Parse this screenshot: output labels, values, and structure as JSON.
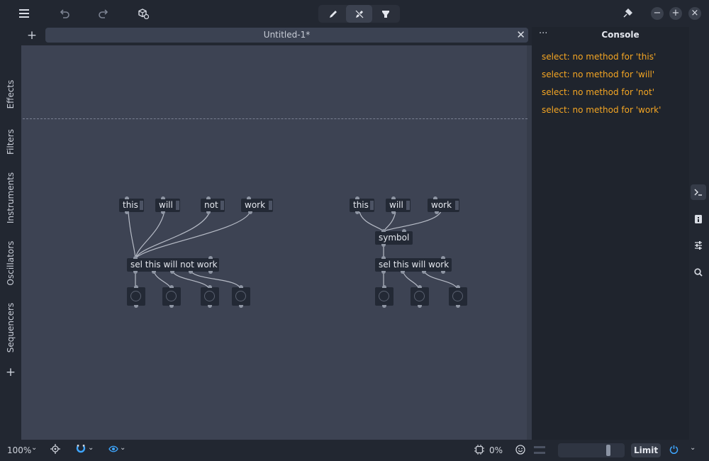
{
  "topbar": {
    "icons": [
      "menu-icon",
      "undo-icon",
      "redo-icon",
      "add-object-icon",
      "edit-mode-icon",
      "run-mode-icon",
      "presentation-mode-icon",
      "plugin-icon",
      "minimize-icon",
      "maximize-icon",
      "close-icon"
    ]
  },
  "tab": {
    "title": "Untitled-1*",
    "add_label": "+",
    "close_label": "✕"
  },
  "sidebar": {
    "categories": [
      "Effects",
      "Filters",
      "Instruments",
      "Oscillators",
      "Sequencers"
    ],
    "add_label": "+"
  },
  "patch_left": {
    "messages": [
      "this",
      "will",
      "not",
      "work"
    ],
    "select_object": "sel this will not work"
  },
  "patch_right": {
    "messages": [
      "this",
      "will",
      "work"
    ],
    "symbol_object": "symbol",
    "select_object": "sel this will work"
  },
  "console": {
    "title": "Console",
    "menu_label": "···",
    "lines": [
      "select: no method for 'this'",
      "select: no method for 'will'",
      "select: no method for 'not'",
      "select: no method for 'work'"
    ]
  },
  "statusbar": {
    "zoom": "100%",
    "cpu": "0%",
    "limit_label": "Limit",
    "volume_level": 0.78
  },
  "colors": {
    "canvas": "#3d4353",
    "object": "#232935",
    "console_warning": "#f5a623",
    "accent": "#3ea6ff"
  }
}
